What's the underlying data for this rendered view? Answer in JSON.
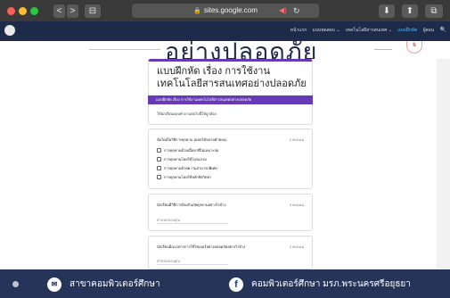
{
  "browser": {
    "url": "sites.google.com",
    "back_label": "<",
    "forward_label": ">",
    "sidebar_label": "⊟",
    "download_label": "⬇",
    "share_label": "⬆",
    "tabs_label": "⧉"
  },
  "site": {
    "nav": [
      {
        "label": "หน้าแรก",
        "active": false
      },
      {
        "label": "แบบทดสอบ ⌄",
        "active": false
      },
      {
        "label": "เทคโนโลยีสารสนเทศ ⌄",
        "active": false
      },
      {
        "label": "แบบฝึกหัด",
        "active": true
      },
      {
        "label": "ผู้สอน",
        "active": false
      }
    ],
    "search_icon_glyph": "🔍",
    "banner_title": "อย่างปลอดภัย"
  },
  "form": {
    "title": "แบบฝึกหัด เรื่อง การใช้งานเทคโนโลยีสารสนเทศอย่างปลอดภัย",
    "purple_bar_text": "แบบฝึกหัด เรื่อง การใช้งานเทคโนโลยีสารสนเทศอย่างปลอดภัย",
    "description": "ให้นักเรียนตอบคำถามต่อไปนี้ให้ถูกต้อง",
    "questions": [
      {
        "title": "ข้อใดเป็นวิธีการคุกคาม (ตอบได้หลายคำตอบ)",
        "points": "2 คะแนน",
        "options": [
          "การคุกคามด้วยเนื้อหาที่ไม่เหมาะสม",
          "การคุกคามโดยใช้โปรแกรม",
          "การคุกคามด้วยความสามารถพิเศษ",
          "การคุกคามโดยใช้หลักจิตวิทยา"
        ]
      },
      {
        "title": "นักเรียนมีวิธีการป้องกันภัยคุกคามอย่างไรบ้าง",
        "points": "3 คะแนน",
        "answer_placeholder": "คำตอบของคุณ"
      },
      {
        "title": "นักเรียนมีแนวทางการใช้ไซเบอร์อย่างปลอดภัยอย่างไรบ้าง",
        "points": "3 คะแนน",
        "answer_placeholder": "คำตอบของคุณ"
      }
    ]
  },
  "footer": {
    "left_text": "สาขาคอมพิวเตอร์ศึกษา",
    "right_text": "คอมพิวเตอร์ศึกษา มรภ.พระนครศรีอยุธยา",
    "left_icon": "✉",
    "right_icon": "f"
  },
  "colors": {
    "site_header": "#1e2a4a",
    "form_accent": "#673ab7",
    "footer": "#27345a"
  }
}
